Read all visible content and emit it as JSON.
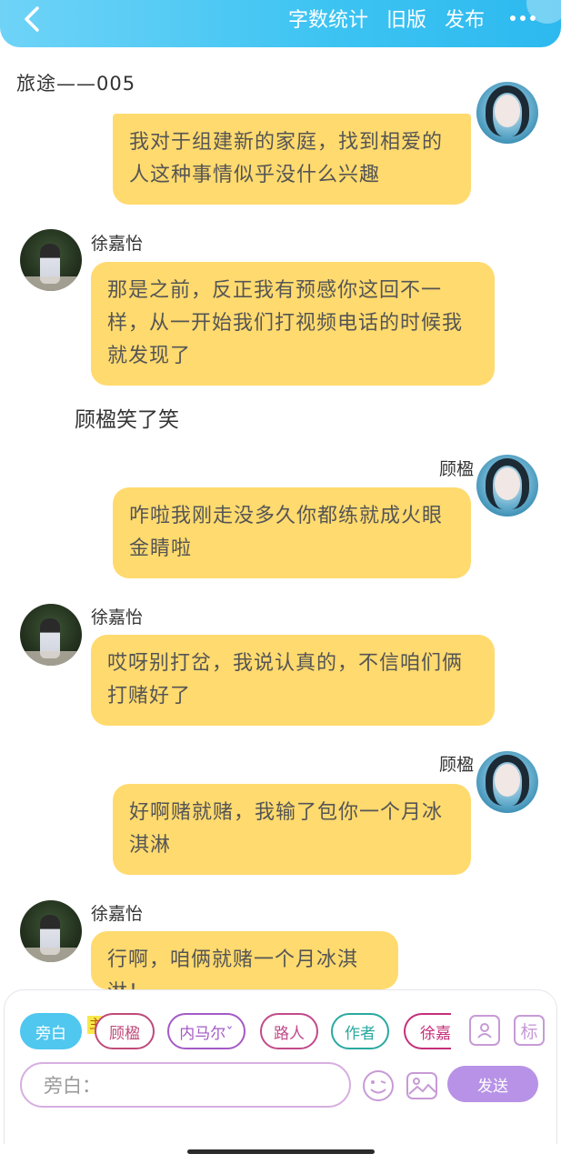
{
  "header": {
    "back_icon": "chevron-left-icon",
    "word_count_label": "字数统计",
    "old_version_label": "旧版",
    "publish_label": "发布",
    "more_icon": "more-horizontal-icon"
  },
  "chapter_title": "旅途——005",
  "messages": [
    {
      "text": "我对于组建新的家庭，找到相爱的人这种事情似乎没什么兴趣"
    },
    {
      "speaker": "徐嘉怡",
      "text": "那是之前，反正我有预感你这回不一样，从一开始我们打视频电话的时候我就发现了"
    },
    {
      "narration": "顾楹笑了笑"
    },
    {
      "speaker": "顾楹",
      "text": "咋啦我刚走没多久你都练就成火眼金睛啦"
    },
    {
      "speaker": "徐嘉怡",
      "text": "哎呀别打岔，我说认真的，不信咱们俩打赌好了"
    },
    {
      "speaker": "顾楹",
      "text": "好啊赌就赌，我输了包你一个月冰淇淋"
    },
    {
      "speaker": "徐嘉怡",
      "text": "行啊，咱俩就赌一个月冰淇淋！"
    }
  ],
  "composer": {
    "roles": [
      "旁白",
      "顾楹",
      "内马尔ˇ",
      "路人",
      "作者",
      "徐嘉怡"
    ],
    "host_tag": "主",
    "profile_icon": "contact-card-icon",
    "tag_label": "标",
    "input_placeholder": "旁白：",
    "emoji_icon": "emoji-icon",
    "image_icon": "image-icon",
    "send_label": "发送"
  },
  "colors": {
    "header_gradient": "#3cc3f2",
    "bubble": "#ffda6e",
    "active_chip": "#4fc7ef",
    "send_button": "#b792e6",
    "role_gu": "#c04a7a",
    "role_nei": "#a45ac6",
    "role_lu": "#c24a8a",
    "role_zuo": "#2aa9a0",
    "role_xu": "#c4307a"
  }
}
